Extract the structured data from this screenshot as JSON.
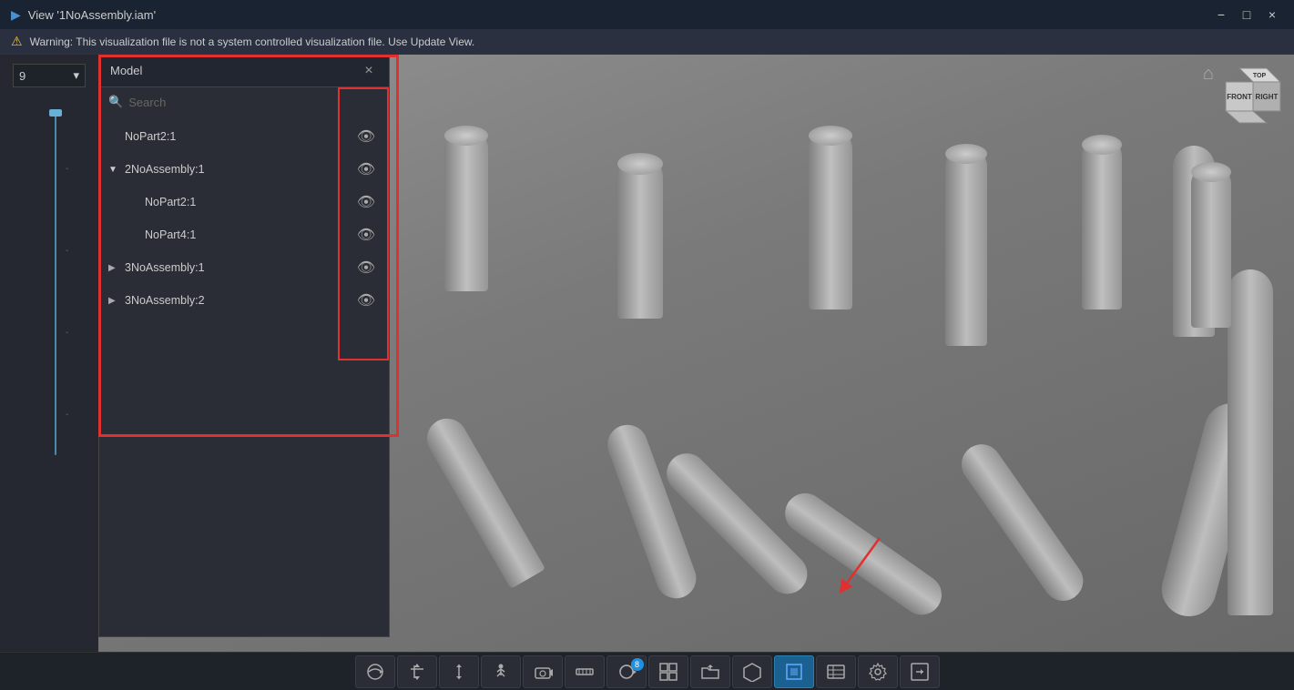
{
  "titlebar": {
    "title": "View '1NoAssembly.iam'",
    "minimize_label": "−",
    "maximize_label": "□",
    "close_label": "×"
  },
  "warning": {
    "icon": "⚠",
    "text": "Warning: This visualization file is not a system controlled visualization file. Use Update View."
  },
  "left_sidebar": {
    "number_value": "9",
    "dropdown_arrow": "▾"
  },
  "model_panel": {
    "title": "Model",
    "close_label": "×",
    "search_placeholder": "Search",
    "items": [
      {
        "id": "noPart2_1",
        "label": "NoPart2:1",
        "indent": "root",
        "expanded": false,
        "has_arrow": false
      },
      {
        "id": "2NoAssembly_1",
        "label": "2NoAssembly:1",
        "indent": "root",
        "expanded": true,
        "has_arrow": true
      },
      {
        "id": "noPart2_1_child",
        "label": "NoPart2:1",
        "indent": "child",
        "expanded": false,
        "has_arrow": false
      },
      {
        "id": "noPart4_1",
        "label": "NoPart4:1",
        "indent": "child",
        "expanded": false,
        "has_arrow": false
      },
      {
        "id": "3NoAssembly_1",
        "label": "3NoAssembly:1",
        "indent": "root",
        "expanded": false,
        "has_arrow": true
      },
      {
        "id": "3NoAssembly_2",
        "label": "3NoAssembly:2",
        "indent": "root",
        "expanded": false,
        "has_arrow": true
      }
    ]
  },
  "toolbar": {
    "buttons": [
      {
        "id": "orbit",
        "icon": "⊕",
        "label": "Orbit"
      },
      {
        "id": "pan",
        "icon": "✋",
        "label": "Pan"
      },
      {
        "id": "zoom",
        "icon": "↕",
        "label": "Zoom"
      },
      {
        "id": "walk",
        "icon": "🚶",
        "label": "Walk"
      },
      {
        "id": "camera",
        "icon": "📷",
        "label": "Camera"
      },
      {
        "id": "measure",
        "icon": "📏",
        "label": "Measure"
      },
      {
        "id": "rotate",
        "icon": "⟳",
        "label": "Rotate"
      },
      {
        "id": "assembly1",
        "icon": "⊞",
        "label": "Assembly",
        "badge": "8"
      },
      {
        "id": "open",
        "icon": "📂",
        "label": "Open"
      },
      {
        "id": "part",
        "icon": "⬡",
        "label": "Part"
      },
      {
        "id": "highlight",
        "icon": "◈",
        "label": "Highlight",
        "active": true
      },
      {
        "id": "visibility",
        "icon": "▦",
        "label": "Visibility"
      },
      {
        "id": "settings",
        "icon": "⚙",
        "label": "Settings"
      },
      {
        "id": "export",
        "icon": "⊡",
        "label": "Export"
      }
    ]
  },
  "colors": {
    "background": "#7a7a7a",
    "panel_bg": "#2a2d35",
    "header_bg": "#1a2332",
    "warning_bg": "#2a3040",
    "toolbar_bg": "#1e2229",
    "red_highlight": "#e03030",
    "accent_blue": "#2090e0"
  }
}
